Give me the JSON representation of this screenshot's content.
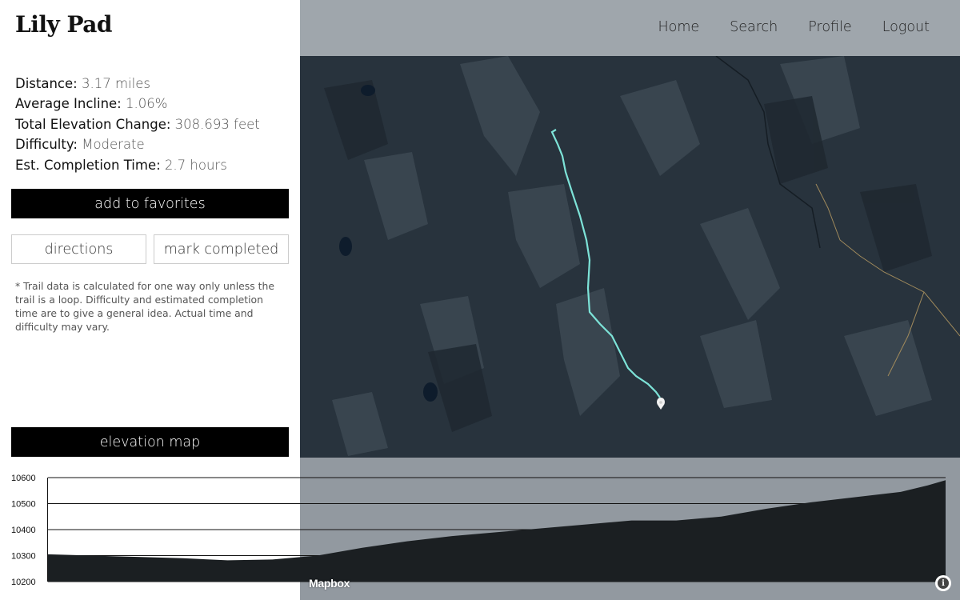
{
  "app": {
    "title": "Lily Pad"
  },
  "nav": {
    "items": [
      "Home",
      "Search",
      "Profile",
      "Logout"
    ]
  },
  "stats": [
    {
      "label": "Distance:",
      "value": "3.17 miles"
    },
    {
      "label": "Average Incline:",
      "value": "1.06%"
    },
    {
      "label": "Total Elevation Change:",
      "value": "308.693 feet"
    },
    {
      "label": "Difficulty:",
      "value": "Moderate"
    },
    {
      "label": "Est. Completion Time:",
      "value": "2.7 hours"
    }
  ],
  "buttons": {
    "favorites": "add to favorites",
    "directions": "directions",
    "mark_completed": "mark completed",
    "elevation_map": "elevation map"
  },
  "note": "* Trail data is calculated for one way only unless the trail is a loop. Difficulty and estimated completion time are to give a general idea. Actual time and difficulty may vary.",
  "map": {
    "attribution_logo": "Mapbox",
    "trail_color": "#7de3d8",
    "marker_color": "#f2f2f2"
  },
  "chart_data": {
    "type": "area",
    "y_ticks": [
      "10600",
      "10500",
      "10400",
      "10300",
      "10200"
    ],
    "ylim": [
      10200,
      10600
    ],
    "x": [
      0,
      0.05,
      0.1,
      0.15,
      0.2,
      0.25,
      0.3,
      0.35,
      0.4,
      0.45,
      0.5,
      0.55,
      0.6,
      0.65,
      0.7,
      0.75,
      0.8,
      0.85,
      0.9,
      0.95,
      0.98,
      1.0
    ],
    "values": [
      10305,
      10300,
      10295,
      10290,
      10282,
      10285,
      10300,
      10330,
      10355,
      10375,
      10390,
      10405,
      10420,
      10435,
      10435,
      10450,
      10480,
      10505,
      10525,
      10545,
      10570,
      10590
    ],
    "fill_color": "#1b1f22",
    "grid": true
  }
}
